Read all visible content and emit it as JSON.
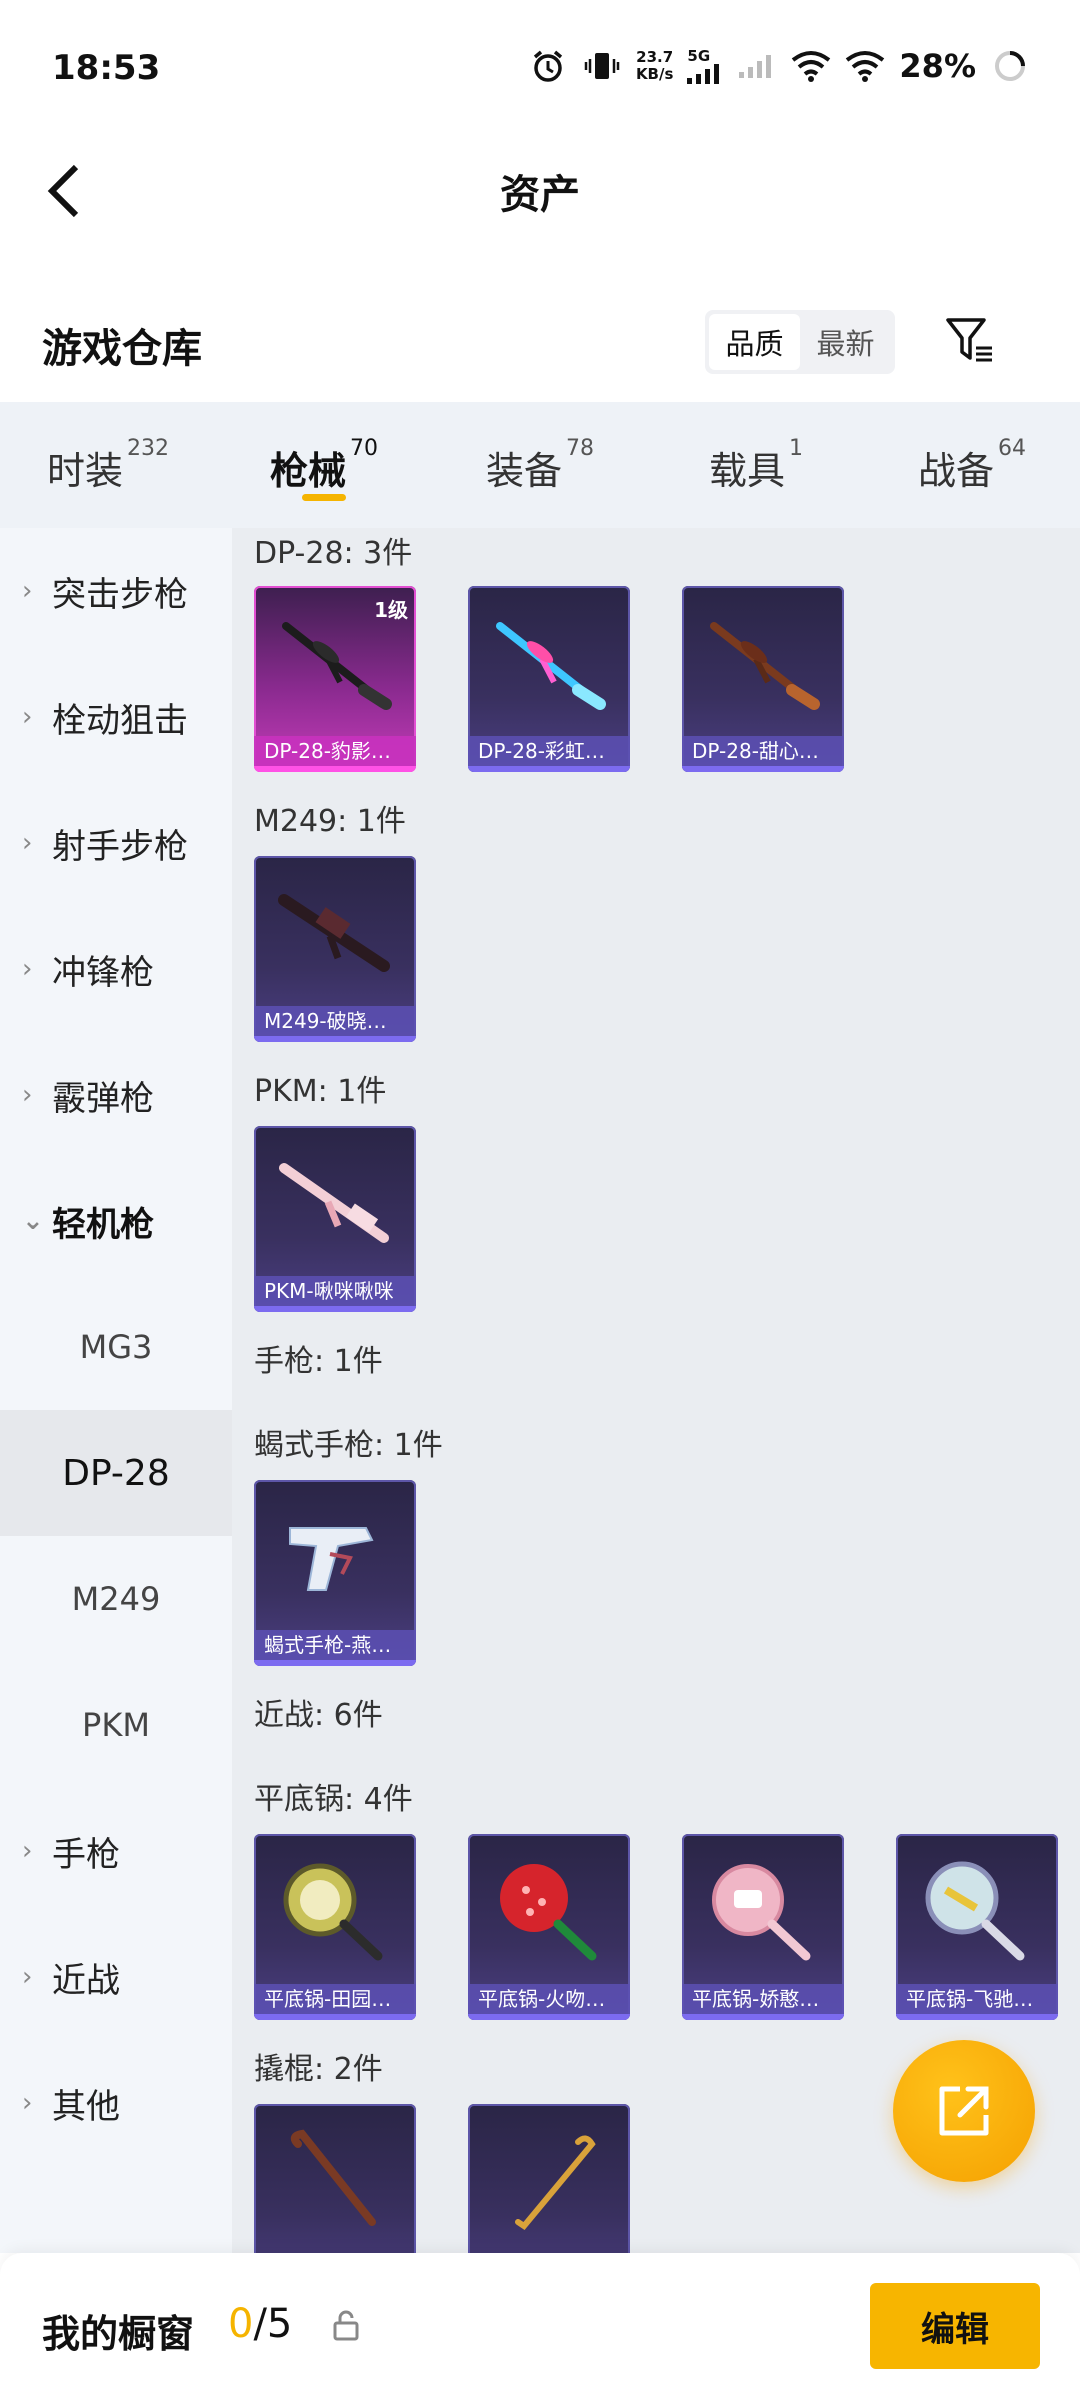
{
  "status_bar": {
    "time": "18:53",
    "speed_value": "23.7",
    "speed_unit": "KB/s",
    "network_label": "5G",
    "battery": "28%",
    "icons": [
      "alarm-icon",
      "vibrate-icon",
      "signal-icon",
      "signal-weak-icon",
      "wifi-icon",
      "wifi-icon",
      "battery-loading-icon"
    ]
  },
  "header": {
    "title": "资产",
    "back_icon": "chevron-left-icon"
  },
  "warehouse": {
    "title": "游戏仓库",
    "sort_options": [
      "品质",
      "最新"
    ],
    "sort_selected": "品质",
    "filter_icon": "filter-icon"
  },
  "tabs": [
    {
      "label": "时装",
      "count": "232"
    },
    {
      "label": "枪械",
      "count": "70"
    },
    {
      "label": "装备",
      "count": "78"
    },
    {
      "label": "载具",
      "count": "1"
    },
    {
      "label": "战备",
      "count": "64"
    }
  ],
  "active_tab": "枪械",
  "sidebar": {
    "categories": [
      {
        "label": "突击步枪"
      },
      {
        "label": "栓动狙击"
      },
      {
        "label": "射手步枪"
      },
      {
        "label": "冲锋枪"
      },
      {
        "label": "霰弹枪"
      },
      {
        "label": "轻机枪"
      },
      {
        "label": "手枪"
      },
      {
        "label": "近战"
      },
      {
        "label": "其他"
      }
    ],
    "subitems": [
      "MG3",
      "DP-28",
      "M249",
      "PKM"
    ],
    "selected_subitem": "DP-28"
  },
  "content": {
    "groups": [
      {
        "label": "DP-28: 3件",
        "items": [
          {
            "name": "DP-28-豹影…",
            "level": "1级",
            "rarity": "pink"
          },
          {
            "name": "DP-28-彩虹…",
            "rarity": "purple"
          },
          {
            "name": "DP-28-甜心…",
            "rarity": "purple"
          }
        ]
      },
      {
        "label": "M249: 1件",
        "items": [
          {
            "name": "M249-破晓…",
            "rarity": "purple"
          }
        ]
      },
      {
        "label": "PKM: 1件",
        "items": [
          {
            "name": "PKM-啾咪啾咪",
            "rarity": "purple"
          }
        ]
      },
      {
        "label": "手枪: 1件",
        "items": []
      },
      {
        "label": "蝎式手枪: 1件",
        "items": [
          {
            "name": "蝎式手枪-燕…",
            "rarity": "purple"
          }
        ]
      },
      {
        "label": "近战: 6件",
        "items": []
      },
      {
        "label": "平底锅: 4件",
        "items": [
          {
            "name": "平底锅-田园…",
            "rarity": "purple"
          },
          {
            "name": "平底锅-火吻…",
            "rarity": "purple"
          },
          {
            "name": "平底锅-娇憨…",
            "rarity": "purple"
          },
          {
            "name": "平底锅-飞驰…",
            "rarity": "purple"
          }
        ]
      },
      {
        "label": "撬棍: 2件",
        "items": [
          {
            "name": "",
            "rarity": "purple"
          },
          {
            "name": "",
            "rarity": "purple"
          }
        ]
      }
    ]
  },
  "fab_icon": "share-icon",
  "bottom_bar": {
    "title": "我的橱窗",
    "count_current": "0",
    "count_total": "/5",
    "lock_icon": "lock-icon",
    "edit_label": "编辑"
  },
  "colors": {
    "accent": "#f5b400",
    "card_purple": "#39305f",
    "card_pink": "#c43cb8"
  }
}
